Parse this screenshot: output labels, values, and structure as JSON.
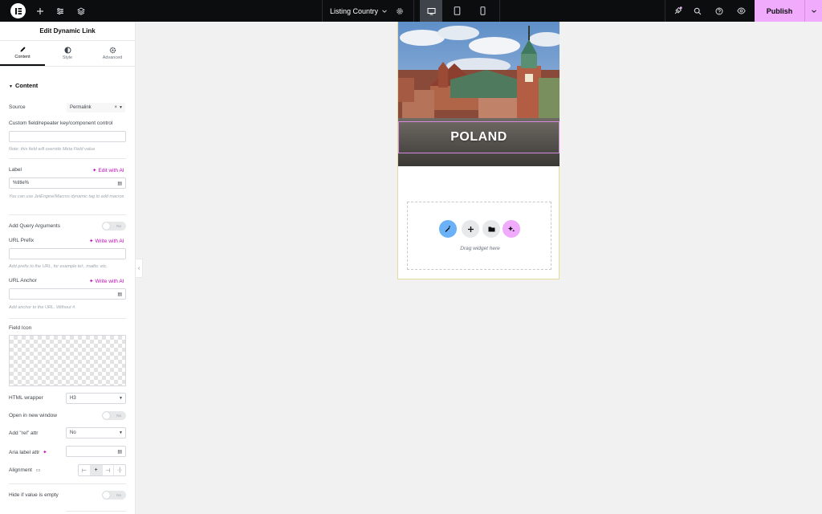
{
  "topbar": {
    "logo_letter": "E",
    "title": "Listing Country",
    "publish": "Publish"
  },
  "panel": {
    "title": "Edit Dynamic Link",
    "tabs": [
      {
        "label": "Content",
        "icon": "pencil-icon"
      },
      {
        "label": "Style",
        "icon": "half-circle-icon"
      },
      {
        "label": "Advanced",
        "icon": "gear-icon"
      }
    ],
    "section": "Content",
    "source_label": "Source",
    "source_value": "Permalink",
    "custom_field_label": "Custom field/repeater key/component control",
    "custom_field_note": "Note: this field will override Meta Field value",
    "label_label": "Label",
    "edit_with_ai": "Edit with AI",
    "label_value": "%title%",
    "label_note": "You can use JetEngine/Macros dynamic tag to add macros",
    "query_args_label": "Add Query Arguments",
    "toggle_no": "No",
    "url_prefix_label": "URL Prefix",
    "write_with_ai": "Write with AI",
    "url_prefix_note": "Add prefix to the URL, for example tel:, mailto: etc.",
    "url_anchor_label": "URL Anchor",
    "url_anchor_note": "Add anchor to the URL. Without #.",
    "field_icon_label": "Field Icon",
    "html_wrapper_label": "HTML wrapper",
    "html_wrapper_value": "H3",
    "new_window_label": "Open in new window",
    "rel_label": "Add \"rel\" attr",
    "rel_value": "No",
    "aria_label": "Aria label attr",
    "alignment_label": "Alignment",
    "hide_empty_label": "Hide if value is empty"
  },
  "canvas": {
    "hero_title": "POLAND",
    "drag_text": "Drag widget here"
  },
  "colors": {
    "publish": "#f0abfc",
    "ai_accent": "#c00bb9",
    "dz_blue": "#6ab1f7",
    "dz_pink": "#f0abfc"
  }
}
